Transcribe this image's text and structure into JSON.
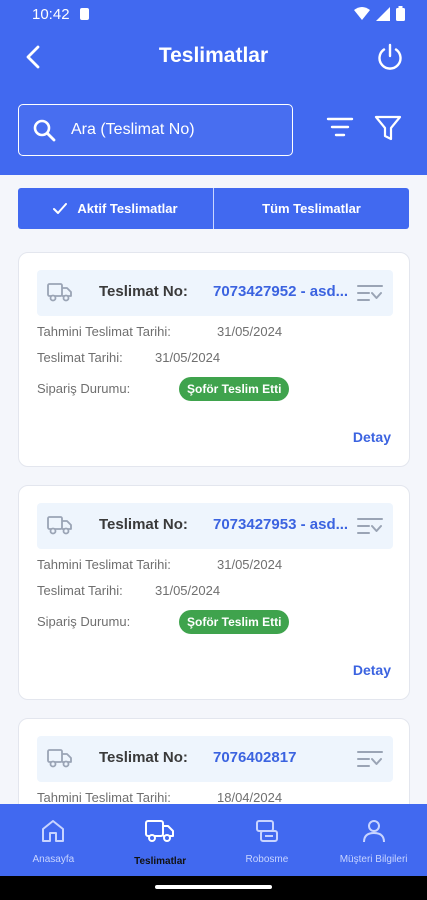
{
  "status": {
    "time": "10:42"
  },
  "header": {
    "title": "Teslimatlar"
  },
  "search": {
    "placeholder": "Ara (Teslimat No)"
  },
  "segments": [
    {
      "label": "Aktif Teslimatlar",
      "selected": true
    },
    {
      "label": "Tüm Teslimatlar",
      "selected": false
    }
  ],
  "deliveries": [
    {
      "label": "Teslimat No:",
      "number": "7073427952 - asd...",
      "estimated_label": "Tahmini Teslimat Tarihi:",
      "estimated_date": "31/05/2024",
      "delivery_label": "Teslimat Tarihi:",
      "delivery_date": "31/05/2024",
      "status_label": "Sipariş Durumu:",
      "status": "Şoför Teslim Etti",
      "detail": "Detay"
    },
    {
      "label": "Teslimat No:",
      "number": "7073427953 - asd...",
      "estimated_label": "Tahmini Teslimat Tarihi:",
      "estimated_date": "31/05/2024",
      "delivery_label": "Teslimat Tarihi:",
      "delivery_date": "31/05/2024",
      "status_label": "Sipariş Durumu:",
      "status": "Şoför Teslim Etti",
      "detail": "Detay"
    },
    {
      "label": "Teslimat No:",
      "number": "7076402817",
      "estimated_label": "Tahmini Teslimat Tarihi:",
      "estimated_date": "18/04/2024"
    }
  ],
  "bottom_nav": [
    {
      "label": "Anasayfa",
      "icon": "home-icon"
    },
    {
      "label": "Teslimatlar",
      "icon": "truck-icon",
      "active": true
    },
    {
      "label": "Robosme",
      "icon": "robot-icon"
    },
    {
      "label": "Müşteri Bilgileri",
      "icon": "user-icon"
    }
  ],
  "colors": {
    "primary": "#4169f0",
    "accent_text": "#3b63e0",
    "status_green": "#3fa34d"
  }
}
